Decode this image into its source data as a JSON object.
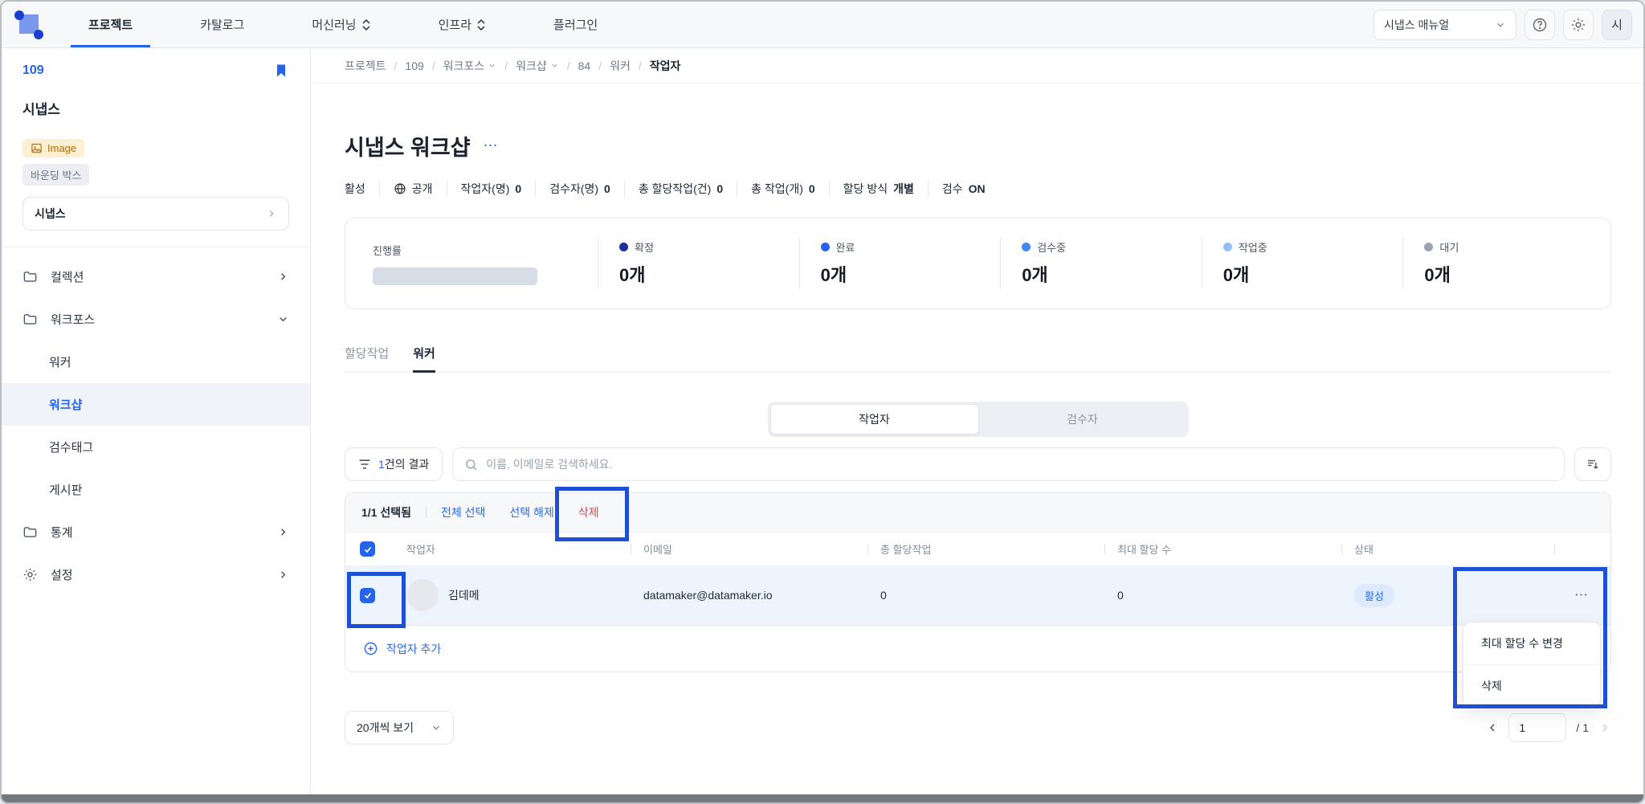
{
  "colors": {
    "annotation": "#1f4fd6",
    "accent": "#2563eb",
    "danger": "#d9434a"
  },
  "navbar": {
    "items": [
      {
        "label": "프로젝트",
        "active": true,
        "caret": false
      },
      {
        "label": "카탈로그",
        "active": false,
        "caret": false
      },
      {
        "label": "머신러닝",
        "active": false,
        "caret": true
      },
      {
        "label": "인프라",
        "active": false,
        "caret": true
      },
      {
        "label": "플러그인",
        "active": false,
        "caret": false
      }
    ],
    "manual_select": {
      "value": "시냅스 매뉴얼"
    },
    "avatar": "시"
  },
  "sidebar": {
    "project_id": "109",
    "project_name": "시냅스",
    "badges": {
      "image": "Image",
      "task": "바운딩 박스"
    },
    "dataset_select": {
      "value": "시냅스"
    },
    "menu": {
      "collection": "컬렉션",
      "workforce": "워크포스",
      "stats": "통계",
      "settings": "설정"
    },
    "submenu": [
      {
        "label": "워커"
      },
      {
        "label": "워크샵",
        "active": true
      },
      {
        "label": "검수태그"
      },
      {
        "label": "게시판"
      }
    ]
  },
  "breadcrumb": {
    "items": [
      "프로젝트",
      "109",
      "워크포스",
      "워크샵",
      "84",
      "워커",
      "작업자"
    ]
  },
  "page": {
    "title": "시냅스 워크샵",
    "more": "⋯"
  },
  "status": {
    "items": [
      {
        "label": "활성",
        "value": ""
      },
      {
        "label": "공개",
        "value": "",
        "icon": "globe"
      },
      {
        "label": "작업자(명)",
        "value": "0"
      },
      {
        "label": "검수자(명)",
        "value": "0"
      },
      {
        "label": "총 할당작업(건)",
        "value": "0"
      },
      {
        "label": "총 작업(개)",
        "value": "0"
      },
      {
        "label": "할당 방식",
        "value": "개별"
      },
      {
        "label": "검수",
        "value": "ON"
      }
    ]
  },
  "progress": {
    "label": "진행률",
    "stats": [
      {
        "label": "확정",
        "value": "0개",
        "color": "#1e2f9e"
      },
      {
        "label": "완료",
        "value": "0개",
        "color": "#2563eb"
      },
      {
        "label": "검수중",
        "value": "0개",
        "color": "#4285f4"
      },
      {
        "label": "작업중",
        "value": "0개",
        "color": "#93c0fa"
      },
      {
        "label": "대기",
        "value": "0개",
        "color": "#9aa5b4"
      }
    ]
  },
  "tabs": {
    "items": [
      {
        "label": "할당작업"
      },
      {
        "label": "워커",
        "active": true
      }
    ]
  },
  "segmented": {
    "options": [
      {
        "label": "작업자",
        "active": true
      },
      {
        "label": "검수자"
      }
    ]
  },
  "filter": {
    "count": "1",
    "count_suffix": "건의 결과"
  },
  "search": {
    "placeholder": "이름, 이메일로 검색하세요."
  },
  "selection": {
    "selected": "1/1 선택됨",
    "select_all": "전체 선택",
    "deselect": "선택 해제",
    "delete": "삭제"
  },
  "table": {
    "columns": [
      "작업자",
      "이메일",
      "총 할당작업",
      "최대 할당 수",
      "상태"
    ],
    "rows": [
      {
        "name": "김데메",
        "email": "datamaker@datamaker.io",
        "total_assigned": "0",
        "max_assigned": "0",
        "status": "활성",
        "more": "⋯"
      }
    ]
  },
  "add_worker": {
    "label": "작업자 추가"
  },
  "context_menu": {
    "items": [
      {
        "label": "최대 할당 수 변경"
      },
      {
        "label": "삭제"
      }
    ]
  },
  "pagination": {
    "page_size": "20개씩 보기",
    "page": "1",
    "total": "/ 1"
  }
}
